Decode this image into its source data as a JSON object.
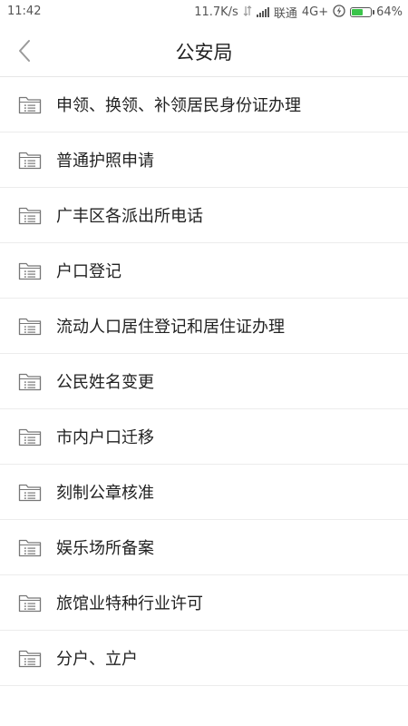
{
  "status_bar": {
    "time": "11:42",
    "net_speed": "11.7K/s",
    "carrier": "联通",
    "network": "4G+",
    "battery_percent": "64%",
    "battery_level": 0.64
  },
  "nav": {
    "title": "公安局",
    "back_icon": "chevron-left-icon"
  },
  "list": {
    "item_icon": "folder-list-icon",
    "items": [
      {
        "label": "申领、换领、补领居民身份证办理"
      },
      {
        "label": "普通护照申请"
      },
      {
        "label": "广丰区各派出所电话"
      },
      {
        "label": "户口登记"
      },
      {
        "label": "流动人口居住登记和居住证办理"
      },
      {
        "label": "公民姓名变更"
      },
      {
        "label": "市内户口迁移"
      },
      {
        "label": "刻制公章核准"
      },
      {
        "label": "娱乐场所备案"
      },
      {
        "label": "旅馆业特种行业许可"
      },
      {
        "label": "分户、立户"
      }
    ]
  },
  "colors": {
    "battery_fill": "#3ac44a",
    "divider": "#ececec",
    "text": "#222222",
    "icon": "#777777"
  }
}
